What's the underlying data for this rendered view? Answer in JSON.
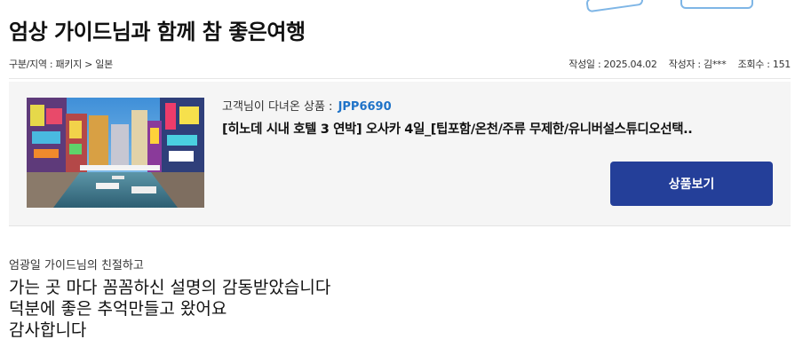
{
  "review": {
    "title": "엄상 가이드님과 함께 참 좋은여행",
    "category": "구분/지역 : 패키지 > 일본",
    "date": "작성일 : 2025.04.02",
    "author": "작성자 : 김***",
    "views": "조회수 : 151"
  },
  "product": {
    "code_label": "고객님이 다녀온 상품 :",
    "code": "JPP6690",
    "name": "[히노데 시내 호텔 3 연박] 오사카 4일_[팁포함/온천/주류 무제한/유니버설스튜디오선택..",
    "button_label": "상품보기",
    "image_icon": "osaka-dotonbori-photo"
  },
  "content": {
    "line1": "엄광일 가이드님의 친절하고",
    "line2": "가는 곳 마다 꼼꼼하신 설명의 감동받았습니다",
    "line3": "덕분에 좋은 추억만들고 왔어요",
    "line4": "감사합니다"
  },
  "colors": {
    "accent_button": "#243f99",
    "product_code": "#1f73c8",
    "card_bg": "#f5f5f5"
  }
}
